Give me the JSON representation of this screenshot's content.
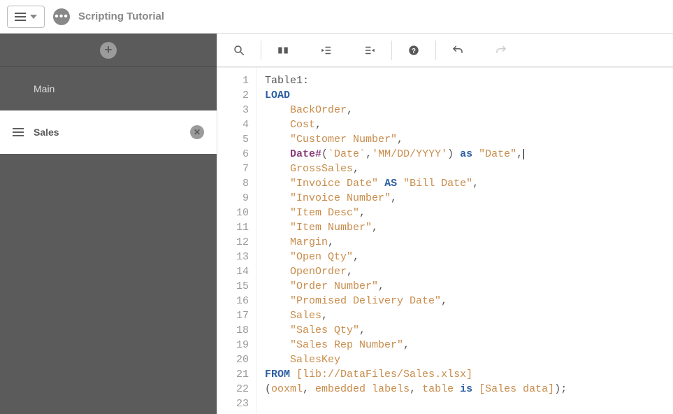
{
  "header": {
    "title": "Scripting Tutorial"
  },
  "sidebar": {
    "sections": [
      {
        "label": "Main",
        "active": false
      },
      {
        "label": "Sales",
        "active": true
      }
    ]
  },
  "code": {
    "lines": [
      [
        {
          "cls": "k-plain",
          "t": "Table1:"
        }
      ],
      [
        {
          "cls": "k-blue",
          "t": "LOAD"
        }
      ],
      [
        {
          "cls": "k-plain",
          "t": "    "
        },
        {
          "cls": "k-orange",
          "t": "BackOrder"
        },
        {
          "cls": "k-comma",
          "t": ","
        }
      ],
      [
        {
          "cls": "k-plain",
          "t": "    "
        },
        {
          "cls": "k-orange",
          "t": "Cost"
        },
        {
          "cls": "k-comma",
          "t": ","
        }
      ],
      [
        {
          "cls": "k-plain",
          "t": "    "
        },
        {
          "cls": "k-str",
          "t": "\"Customer Number\""
        },
        {
          "cls": "k-comma",
          "t": ","
        }
      ],
      [
        {
          "cls": "k-plain",
          "t": "    "
        },
        {
          "cls": "k-func",
          "t": "Date#"
        },
        {
          "cls": "k-plain",
          "t": "("
        },
        {
          "cls": "k-orange",
          "t": "`Date`"
        },
        {
          "cls": "k-comma",
          "t": ","
        },
        {
          "cls": "k-str",
          "t": "'MM/DD/YYYY'"
        },
        {
          "cls": "k-plain",
          "t": ") "
        },
        {
          "cls": "k-blue",
          "t": "as"
        },
        {
          "cls": "k-plain",
          "t": " "
        },
        {
          "cls": "k-str",
          "t": "\"Date\""
        },
        {
          "cls": "k-comma",
          "t": ","
        },
        {
          "cls": "caret",
          "t": ""
        }
      ],
      [
        {
          "cls": "k-plain",
          "t": "    "
        },
        {
          "cls": "k-orange",
          "t": "GrossSales"
        },
        {
          "cls": "k-comma",
          "t": ","
        }
      ],
      [
        {
          "cls": "k-plain",
          "t": "    "
        },
        {
          "cls": "k-str",
          "t": "\"Invoice Date\""
        },
        {
          "cls": "k-plain",
          "t": " "
        },
        {
          "cls": "k-blue",
          "t": "AS"
        },
        {
          "cls": "k-plain",
          "t": " "
        },
        {
          "cls": "k-str",
          "t": "\"Bill Date\""
        },
        {
          "cls": "k-comma",
          "t": ","
        }
      ],
      [
        {
          "cls": "k-plain",
          "t": "    "
        },
        {
          "cls": "k-str",
          "t": "\"Invoice Number\""
        },
        {
          "cls": "k-comma",
          "t": ","
        }
      ],
      [
        {
          "cls": "k-plain",
          "t": "    "
        },
        {
          "cls": "k-str",
          "t": "\"Item Desc\""
        },
        {
          "cls": "k-comma",
          "t": ","
        }
      ],
      [
        {
          "cls": "k-plain",
          "t": "    "
        },
        {
          "cls": "k-str",
          "t": "\"Item Number\""
        },
        {
          "cls": "k-comma",
          "t": ","
        }
      ],
      [
        {
          "cls": "k-plain",
          "t": "    "
        },
        {
          "cls": "k-orange",
          "t": "Margin"
        },
        {
          "cls": "k-comma",
          "t": ","
        }
      ],
      [
        {
          "cls": "k-plain",
          "t": "    "
        },
        {
          "cls": "k-str",
          "t": "\"Open Qty\""
        },
        {
          "cls": "k-comma",
          "t": ","
        }
      ],
      [
        {
          "cls": "k-plain",
          "t": "    "
        },
        {
          "cls": "k-orange",
          "t": "OpenOrder"
        },
        {
          "cls": "k-comma",
          "t": ","
        }
      ],
      [
        {
          "cls": "k-plain",
          "t": "    "
        },
        {
          "cls": "k-str",
          "t": "\"Order Number\""
        },
        {
          "cls": "k-comma",
          "t": ","
        }
      ],
      [
        {
          "cls": "k-plain",
          "t": "    "
        },
        {
          "cls": "k-str",
          "t": "\"Promised Delivery Date\""
        },
        {
          "cls": "k-comma",
          "t": ","
        }
      ],
      [
        {
          "cls": "k-plain",
          "t": "    "
        },
        {
          "cls": "k-orange",
          "t": "Sales"
        },
        {
          "cls": "k-comma",
          "t": ","
        }
      ],
      [
        {
          "cls": "k-plain",
          "t": "    "
        },
        {
          "cls": "k-str",
          "t": "\"Sales Qty\""
        },
        {
          "cls": "k-comma",
          "t": ","
        }
      ],
      [
        {
          "cls": "k-plain",
          "t": "    "
        },
        {
          "cls": "k-str",
          "t": "\"Sales Rep Number\""
        },
        {
          "cls": "k-comma",
          "t": ","
        }
      ],
      [
        {
          "cls": "k-plain",
          "t": "    "
        },
        {
          "cls": "k-orange",
          "t": "SalesKey"
        }
      ],
      [
        {
          "cls": "k-blue",
          "t": "FROM"
        },
        {
          "cls": "k-plain",
          "t": " "
        },
        {
          "cls": "k-bracket",
          "t": "[lib://DataFiles/Sales.xlsx]"
        }
      ],
      [
        {
          "cls": "k-plain",
          "t": "("
        },
        {
          "cls": "k-orange",
          "t": "ooxml"
        },
        {
          "cls": "k-comma",
          "t": ", "
        },
        {
          "cls": "k-orange",
          "t": "embedded labels"
        },
        {
          "cls": "k-comma",
          "t": ", "
        },
        {
          "cls": "k-orange",
          "t": "table"
        },
        {
          "cls": "k-plain",
          "t": " "
        },
        {
          "cls": "k-blue",
          "t": "is"
        },
        {
          "cls": "k-plain",
          "t": " "
        },
        {
          "cls": "k-bracket",
          "t": "[Sales data]"
        },
        {
          "cls": "k-plain",
          "t": ");"
        }
      ],
      [
        {
          "cls": "k-plain",
          "t": ""
        }
      ]
    ]
  }
}
